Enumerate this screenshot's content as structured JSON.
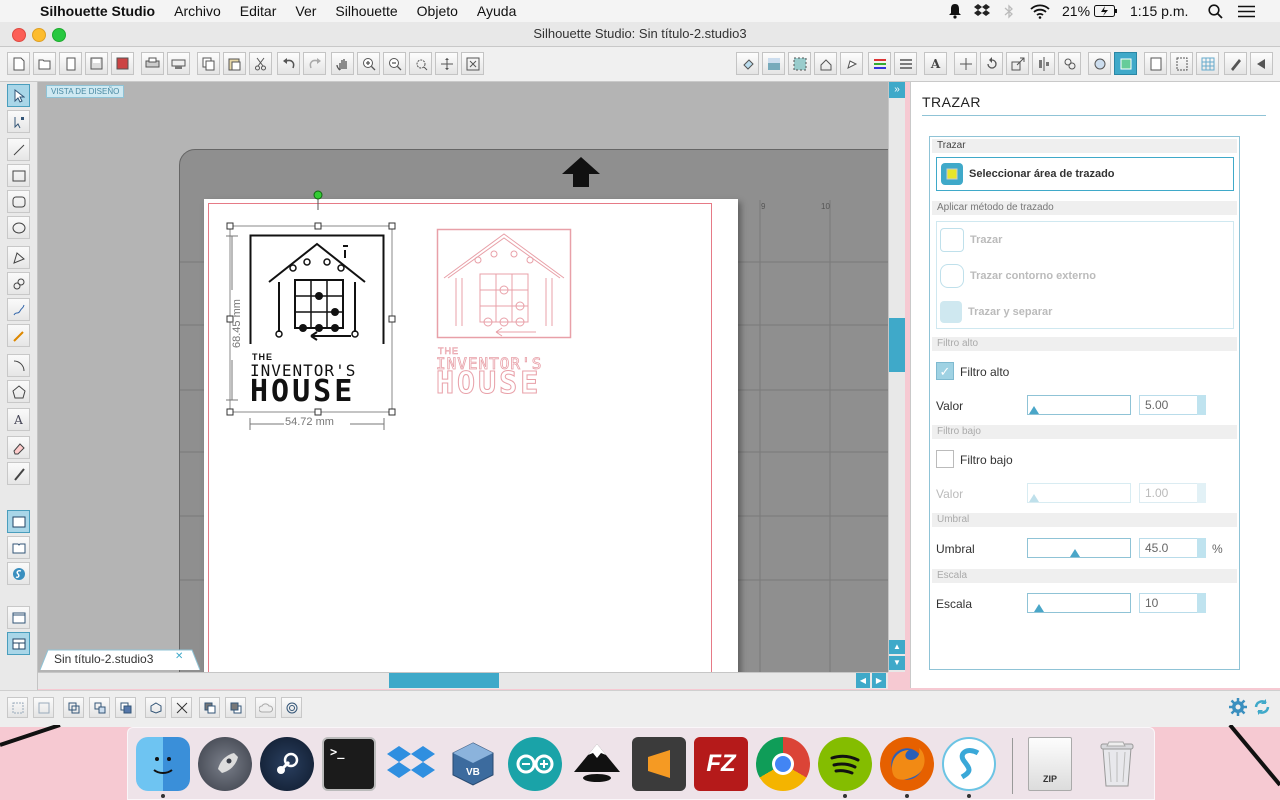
{
  "menubar": {
    "app_name": "Silhouette Studio",
    "items": [
      "Archivo",
      "Editar",
      "Ver",
      "Silhouette",
      "Objeto",
      "Ayuda"
    ],
    "battery": "21%",
    "time": "1:15 p.m."
  },
  "window": {
    "title": "Silhouette Studio: Sin título-2.studio3"
  },
  "canvas": {
    "view_label": "VISTA DE DISEÑO",
    "doc_tab": "Sin título-2.studio3",
    "dim_height": "68.45 mm",
    "dim_width": "54.72 mm",
    "ruler_9": "9",
    "ruler_10": "10",
    "logo_small": "THE",
    "logo_line1": "INVENTOR'S",
    "logo_line2": "HOUSE"
  },
  "panel": {
    "title": "TRAZAR",
    "section_trazar": "Trazar",
    "select_area_button": "Seleccionar área de trazado",
    "section_method": "Aplicar método de trazado",
    "method_trazar": "Trazar",
    "method_outer": "Trazar contorno externo",
    "method_separate": "Trazar y separar",
    "section_high": "Filtro alto",
    "high_checkbox": "Filtro alto",
    "high_value_label": "Valor",
    "high_value": "5.00",
    "section_low": "Filtro bajo",
    "low_checkbox": "Filtro bajo",
    "low_value_label": "Valor",
    "low_value": "1.00",
    "section_threshold": "Umbral",
    "threshold_label": "Umbral",
    "threshold_value": "45.0",
    "threshold_unit": "%",
    "section_scale": "Escala",
    "scale_label": "Escala",
    "scale_value": "10"
  },
  "dock": {
    "apps": [
      "finder-icon",
      "launchpad-icon",
      "steam-icon",
      "terminal-icon",
      "dropbox-icon",
      "virtualbox-icon",
      "arduino-icon",
      "inkscape-icon",
      "sublime-icon",
      "filezilla-icon",
      "chrome-icon",
      "spotify-icon",
      "firefox-icon",
      "silhouette-icon",
      "zip-file-icon",
      "trash-icon"
    ],
    "filezilla_label": "FZ",
    "zip_label": "ZIP"
  },
  "colors": {
    "accent": "#3fa9c9",
    "cut_line": "#e67a86",
    "traced": "#e8a0a8"
  }
}
